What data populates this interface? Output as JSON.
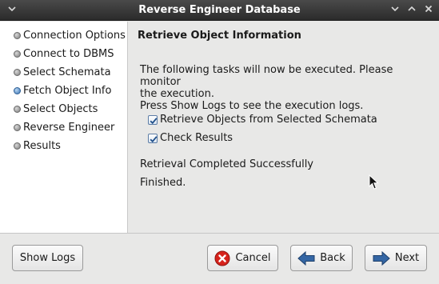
{
  "window": {
    "title": "Reverse Engineer Database"
  },
  "sidebar": {
    "steps": [
      {
        "label": "Connection Options",
        "state": "done"
      },
      {
        "label": "Connect to DBMS",
        "state": "done"
      },
      {
        "label": "Select Schemata",
        "state": "done"
      },
      {
        "label": "Fetch Object Info",
        "state": "current"
      },
      {
        "label": "Select Objects",
        "state": "pending"
      },
      {
        "label": "Reverse Engineer",
        "state": "pending"
      },
      {
        "label": "Results",
        "state": "pending"
      }
    ]
  },
  "main": {
    "heading": "Retrieve Object Information",
    "description_line1": "The following tasks will now be executed. Please monitor",
    "description_line2": "the execution.",
    "description_line3": "Press Show Logs to see the execution logs.",
    "tasks": [
      {
        "label": "Retrieve Objects from Selected Schemata",
        "checked": true
      },
      {
        "label": "Check Results",
        "checked": true
      }
    ],
    "status_message": "Retrieval Completed Successfully",
    "finished_message": "Finished."
  },
  "footer": {
    "show_logs_label": "Show Logs",
    "cancel_label": "Cancel",
    "back_label": "Back",
    "next_label": "Next"
  },
  "colors": {
    "titlebar": "#2b2b2b",
    "active_step": "#3a74b5",
    "cancel_icon": "#d6231c",
    "arrow_icon": "#3466a4"
  }
}
